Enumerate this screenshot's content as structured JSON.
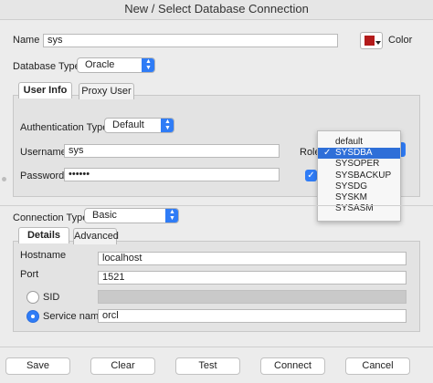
{
  "window": {
    "title": "New / Select Database Connection"
  },
  "connection": {
    "name_label": "Name",
    "name_value": "sys",
    "color_label": "Color",
    "color_swatch": "#b31b1b",
    "db_type_label": "Database Type",
    "db_type_value": "Oracle"
  },
  "user_tabs": [
    {
      "label": "User Info",
      "active": true
    },
    {
      "label": "Proxy User",
      "active": false
    }
  ],
  "auth": {
    "auth_type_label": "Authentication Type",
    "auth_type_value": "Default",
    "username_label": "Username",
    "username_value": "sys",
    "password_label": "Password",
    "password_value": "••••••",
    "role_label": "Role"
  },
  "role_menu": {
    "items": [
      "default",
      "SYSDBA",
      "SYSOPER",
      "SYSBACKUP",
      "SYSDG",
      "SYSKM",
      "SYSASM"
    ],
    "selected": "SYSDBA",
    "check_glyph": "✓"
  },
  "conn_type": {
    "label": "Connection Type",
    "value": "Basic"
  },
  "detail_tabs": [
    {
      "label": "Details",
      "active": true
    },
    {
      "label": "Advanced",
      "active": false
    }
  ],
  "details": {
    "hostname_label": "Hostname",
    "hostname_value": "localhost",
    "port_label": "Port",
    "port_value": "1521",
    "sid_label": "SID",
    "sid_value": "",
    "service_label": "Service name",
    "service_value": "orcl",
    "selected_option": "Service name"
  },
  "buttons": {
    "save": "Save",
    "clear": "Clear",
    "test": "Test",
    "connect": "Connect",
    "cancel": "Cancel"
  },
  "colors": {
    "accent": "#2f7cf6",
    "selection": "#2e6fd8"
  }
}
